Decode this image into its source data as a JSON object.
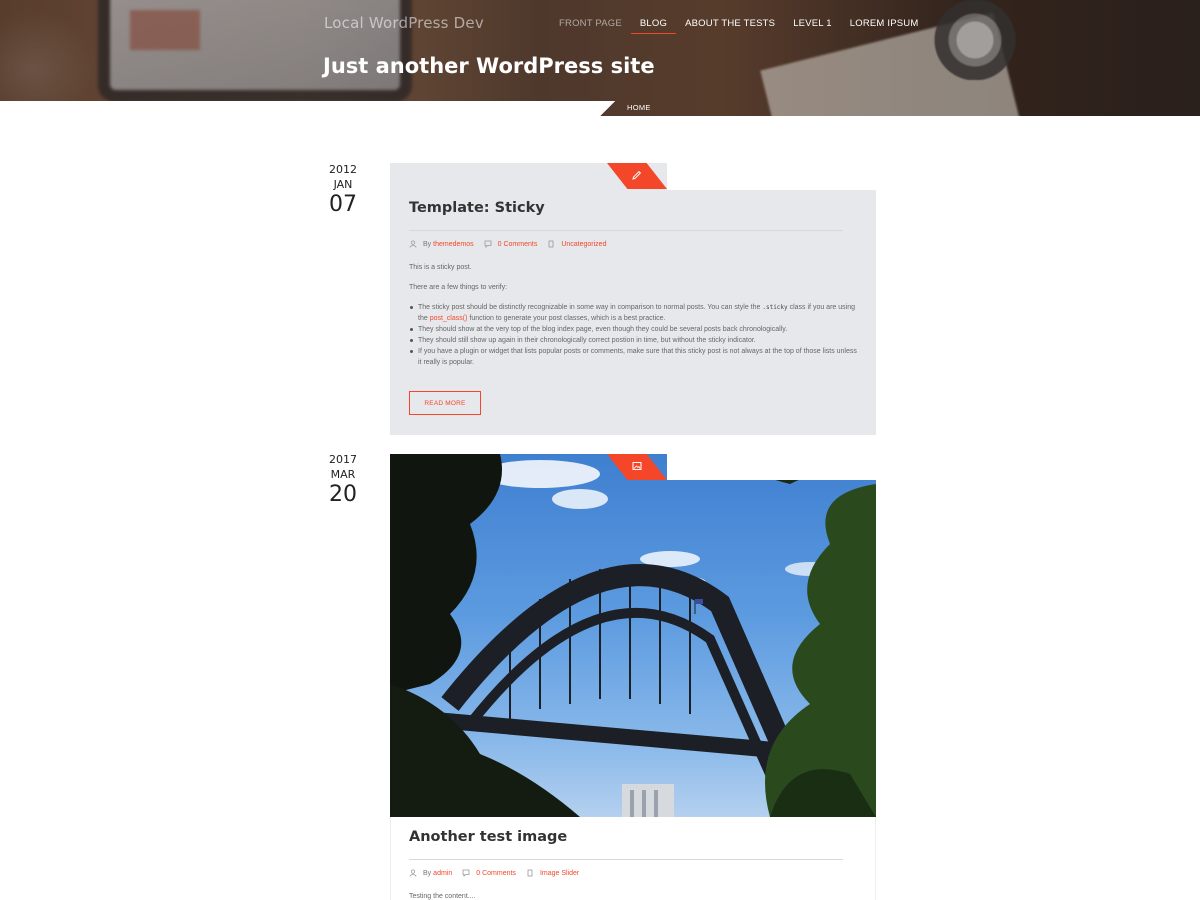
{
  "header": {
    "site_title": "Local WordPress Dev",
    "tagline": "Just another WordPress site",
    "nav": [
      {
        "label": "FRONT PAGE"
      },
      {
        "label": "BLOG"
      },
      {
        "label": "ABOUT THE TESTS"
      },
      {
        "label": "LEVEL 1"
      },
      {
        "label": "LOREM IPSUM"
      }
    ],
    "active_nav": "BLOG",
    "breadcrumb": "HOME"
  },
  "colors": {
    "accent": "#f4472a",
    "card_bg": "#e6e8ec",
    "text": "#555555"
  },
  "posts": [
    {
      "date": {
        "year": "2012",
        "month": "JAN",
        "day": "07"
      },
      "format_icon": "pencil-icon",
      "title": "Template: Sticky",
      "meta": {
        "by": "By",
        "author": "themedemos",
        "comments": "0 Comments",
        "category": "Uncategorized"
      },
      "paragraphs": [
        "This is a sticky post.",
        "There are a few things to verify:"
      ],
      "list": {
        "item1_a": "The sticky post should be distinctly recognizable in some way in comparison to normal posts. You can style the",
        "item1_code": ".sticky",
        "item1_b": "class if you are using",
        "item1_c": "the",
        "item1_link": "post_class()",
        "item1_d": "function to generate your post classes, which is a best practice.",
        "item2": "They should show at the very top of the blog index page, even though they could be several posts back chronologically.",
        "item3": "They should still show up again in their chronologically correct postion in time, but without the sticky indicator.",
        "item4": "If you have a plugin or widget that lists popular posts or comments, make sure that this sticky post is not always at the top of those lists unless it really is popular."
      },
      "read_more": "READ MORE"
    },
    {
      "date": {
        "year": "2017",
        "month": "MAR",
        "day": "20"
      },
      "format_icon": "image-icon",
      "title": "Another test image",
      "meta": {
        "by": "By",
        "author": "admin",
        "comments": "0 Comments",
        "category": "Image Slider"
      },
      "excerpt": "Testing the content...."
    }
  ]
}
